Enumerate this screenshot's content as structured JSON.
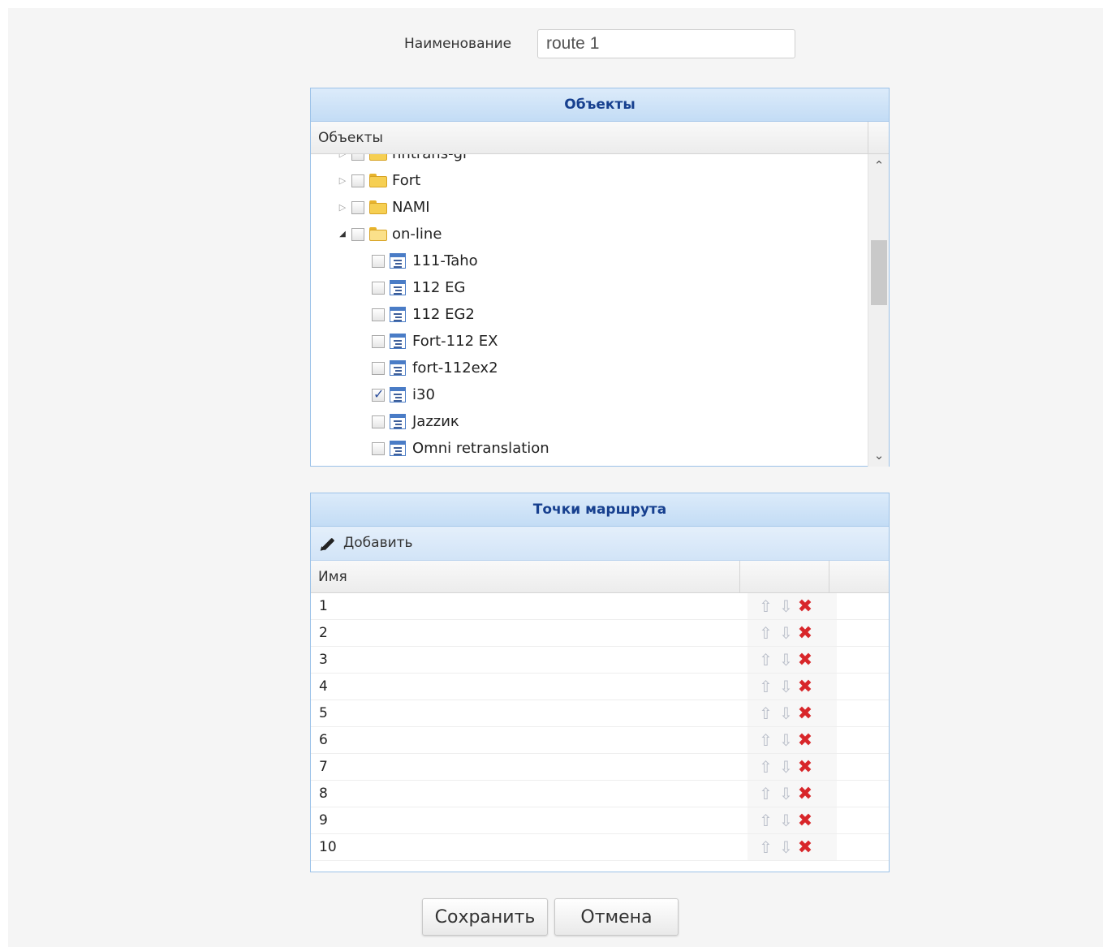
{
  "form": {
    "name_label": "Наименование",
    "name_value": "route 1"
  },
  "objects_panel": {
    "title": "Объекты",
    "column_header": "Объекты",
    "partial_top_item": "nntrans-gr",
    "items": [
      {
        "label": "Fort",
        "type": "folder",
        "expander": "collapsed",
        "checked": false
      },
      {
        "label": "NAMI",
        "type": "folder",
        "expander": "collapsed",
        "checked": false
      },
      {
        "label": "on-line",
        "type": "folder",
        "expander": "expanded",
        "checked": false
      },
      {
        "label": "111-Taho",
        "type": "object",
        "checked": false
      },
      {
        "label": "112 EG",
        "type": "object",
        "checked": false
      },
      {
        "label": "112 EG2",
        "type": "object",
        "checked": false
      },
      {
        "label": "Fort-112 EX",
        "type": "object",
        "checked": false
      },
      {
        "label": "fort-112ex2",
        "type": "object",
        "checked": false
      },
      {
        "label": "i30",
        "type": "object",
        "checked": true
      },
      {
        "label": "Jazzик",
        "type": "object",
        "checked": false
      },
      {
        "label": "Omni retranslation",
        "type": "object",
        "checked": false
      }
    ]
  },
  "points_panel": {
    "title": "Точки маршрута",
    "add_label": "Добавить",
    "column_name": "Имя",
    "rows": [
      "1",
      "2",
      "3",
      "4",
      "5",
      "6",
      "7",
      "8",
      "9",
      "10"
    ]
  },
  "buttons": {
    "save": "Сохранить",
    "cancel": "Отмена"
  },
  "colors": {
    "header_text": "#17408f",
    "delete": "#d8262a",
    "panel_border": "#9cc2e8"
  }
}
